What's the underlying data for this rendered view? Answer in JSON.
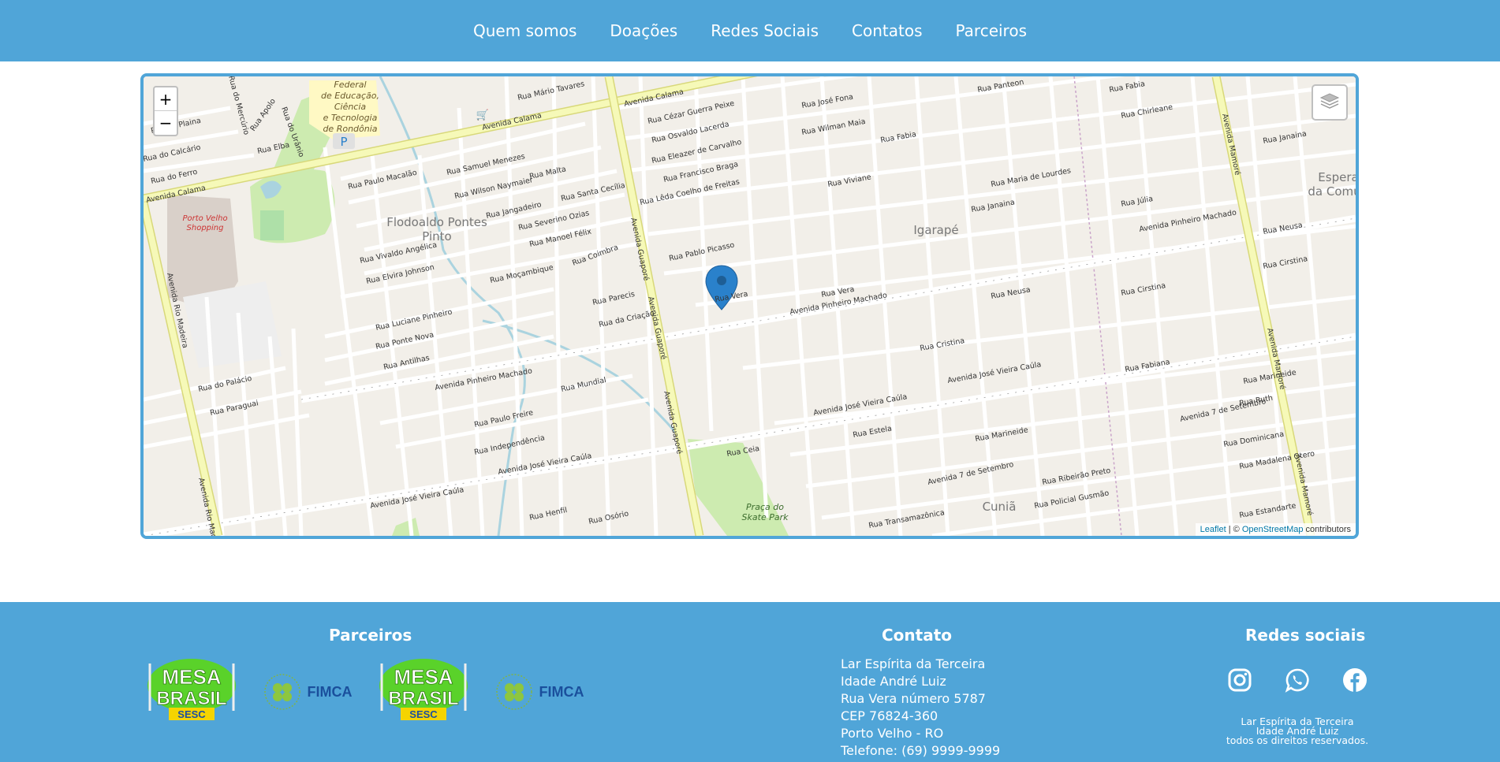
{
  "nav": {
    "items": [
      "Quem somos",
      "Doações",
      "Redes Sociais",
      "Contatos",
      "Parceiros"
    ]
  },
  "map": {
    "zoom_in": "+",
    "zoom_out": "−",
    "attribution_leaflet": "Leaflet",
    "attribution_sep": " | © ",
    "attribution_osm": "OpenStreetMap",
    "attribution_tail": " contributors",
    "marker_street": "Rua Vera",
    "labels": {
      "flodoaldo": [
        "Flodoaldo Pontes",
        "Pinto"
      ],
      "igarape": "Igarapé",
      "cunia": "Cuniã",
      "esperanca": [
        "Espera",
        "da Comu"
      ],
      "shopping": [
        "Porto Velho",
        "Shopping"
      ],
      "federal": [
        "Federal",
        "de Educação,",
        "Ciência",
        "e Tecnologia",
        "de Rondônia"
      ],
      "skate": [
        "Praça do",
        "Skate Park"
      ],
      "avenida_calama": "Avenida Calama",
      "avenida_guapore": "Avenida Guaporé",
      "avenida_pinheiro": "Avenida Pinheiro Machado",
      "avenida_jose_vieira": "Avenida José Vieira Caúla",
      "avenida_mamore": "Avenida Mamoré",
      "avenida_rio_madeira": "Avenida Rio Madeira",
      "avenida_7_setembro": "Avenida 7 de Setembro",
      "rua_cristina": "Rua Cristina",
      "rua_neusa": "Rua Neusa",
      "rua_estela": "Rua Estela",
      "rua_marineide": "Rua Marineide",
      "rua_viviane": "Rua Viviane",
      "rua_fabia": "Rua Fabia",
      "rua_janaina": "Rua Janaina",
      "rua_pablo_picasso": "Rua Pablo Picasso",
      "rua_paulo_macalao": "Rua Paulo Macalão",
      "rua_mundial": "Rua Mundial",
      "rua_paulo_freire": "Rua Paulo Freire",
      "rua_independencia": "Rua Independência",
      "rua_mocambique": "Rua Moçambique",
      "rua_elvira_johnson": "Rua Elvira Johnson",
      "rua_antilhas": "Rua Antilhas",
      "rua_paraguai": "Rua Paraguai",
      "rua_do_palacio": "Rua do Palácio",
      "rua_transamazonica": "Rua Transamazônica",
      "rua_vera_2": "Rua Vera",
      "rua_leda": "Rua Lêda Coelho de Freitas",
      "rua_santa_cecilia": "Rua Santa Cecília",
      "rua_manoel_felix": "Rua Manoel Félix",
      "rua_coimbra": "Rua Coimbra",
      "rua_parecis": "Rua Parecis",
      "rua_da_criacao": "Rua da Criação",
      "rua_henfil": "Rua Henfil",
      "rua_osorio": "Rua Osório",
      "rua_ceia": "Rua Ceia",
      "rua_panteon": "Rua Panteon",
      "rua_chirleane": "Rua Chirleane",
      "rua_julia": "Rua Júlia",
      "rua_neusa_2": "Rua Neusa",
      "rua_cirstina": "Rua Cirstina",
      "rua_fabiana": "Rua Fabiana",
      "rua_ruth": "Rua Ruth",
      "rua_dominicana": "Rua Dominicana",
      "rua_madalena": "Rua Madalena Otero",
      "rua_estandarte": "Rua Estandarte",
      "rua_policial": "Rua Policial Gusmão",
      "rua_ribeirao": "Rua Ribeirão Preto",
      "rua_maria_lourdes": "Rua Maria de Lourdes",
      "rua_jose_fona": "Rua José Fona",
      "rua_wilman": "Rua Wilman Maia",
      "rua_mario_tavares": "Rua Mário Tavares",
      "rua_cezar": "Rua Cézar Guerra Peixe",
      "rua_osvaldo": "Rua Osvaldo Lacerda",
      "rua_eleazer": "Rua Eleazer de Carvalho",
      "rua_francisco": "Rua Francisco Braga",
      "rua_samuel": "Rua Samuel Menezes",
      "rua_wilson": "Rua Wilson Naymaier",
      "rua_malta": "Rua Malta",
      "rua_jangadeiro": "Rua Jangadeiro",
      "rua_severino": "Rua Severino Ozias",
      "rua_vivaldo": "Rua Vivaldo Angélica",
      "rua_luciane": "Rua Luciane Pinheiro",
      "rua_ponte_nova": "Rua Ponte Nova",
      "rua_elba": "Rua Elba",
      "rua_calcario": "Rua do Calcário",
      "rua_ferro": "Rua do Ferro",
      "rua_plaina": "Rua da Plaina",
      "rua_apolo": "Rua Apolo",
      "rua_uranio": "Rua do Urânio",
      "rua_mercurio": "Rua do Mercúrio"
    }
  },
  "footer": {
    "partners_title": "Parceiros",
    "contact_title": "Contato",
    "social_title": "Redes sociais",
    "partners": [
      {
        "name": "mesa-brasil-logo",
        "line1": "MESA",
        "line2": "BRASIL",
        "line3": "SESC"
      },
      {
        "name": "fimca-logo",
        "text": "FIMCA"
      },
      {
        "name": "mesa-brasil-logo",
        "line1": "MESA",
        "line2": "BRASIL",
        "line3": "SESC"
      },
      {
        "name": "fimca-logo",
        "text": "FIMCA"
      }
    ],
    "contact_lines": [
      "Lar Espírita da Terceira",
      "Idade André Luiz",
      "Rua Vera número 5787",
      "CEP 76824-360",
      "Porto Velho - RO",
      "Telefone: (69) 9999-9999"
    ],
    "social_icons": [
      "instagram-icon",
      "whatsapp-icon",
      "facebook-icon"
    ],
    "copyright_lines": [
      "Lar Espírita da Terceira",
      "Idade André Luiz",
      "todos os direitos reservados."
    ]
  },
  "colors": {
    "brand_blue": "#50a5d8",
    "map_bg": "#f2efe9",
    "major_road": "#f6f9b8",
    "major_road_border": "#d8d87a",
    "park": "#cdebb0",
    "marker": "#2a81cb"
  }
}
